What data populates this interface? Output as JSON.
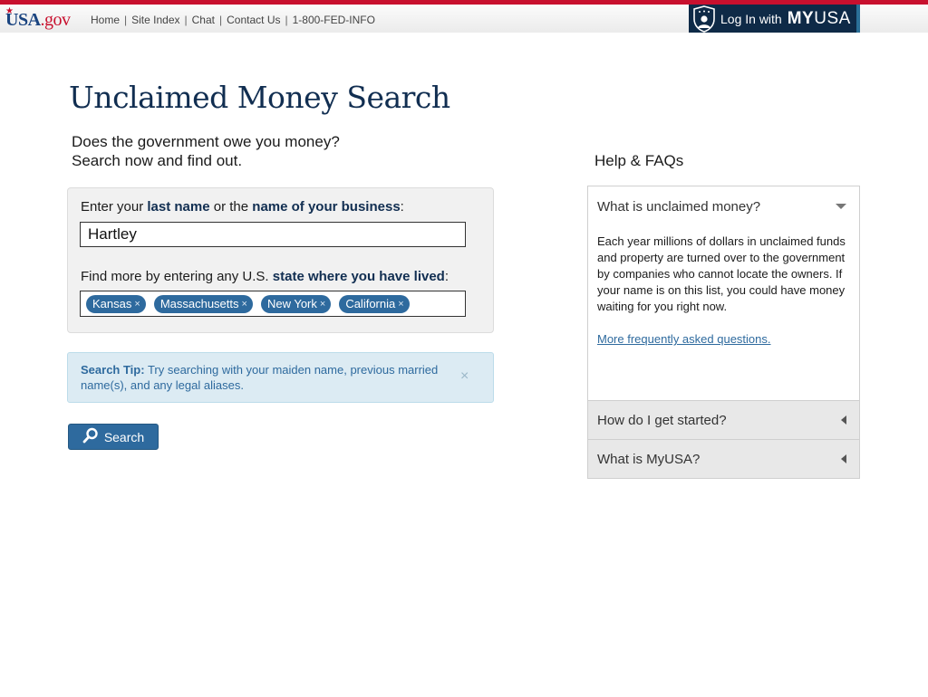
{
  "header": {
    "logo_text_main": "USA",
    "logo_text_suffix": ".gov",
    "nav": [
      "Home",
      "Site Index",
      "Chat",
      "Contact Us",
      "1-800-FED-INFO"
    ],
    "login_prefix": "Log In with",
    "brand_bold": "MY",
    "brand_light": "USA"
  },
  "main": {
    "title": "Unclaimed Money Search",
    "intro_line1": "Does the government owe you money?",
    "intro_line2": "Search now and find out.",
    "name_label_pre": "Enter your ",
    "name_label_b1": "last name",
    "name_label_mid": " or the ",
    "name_label_b2": "name of your business",
    "name_label_post": ":",
    "name_value": "Hartley",
    "state_label_pre": "Find more by entering any U.S. ",
    "state_label_b": "state where you have lived",
    "state_label_post": ":",
    "states": [
      "Kansas",
      "Massachusetts",
      "New York",
      "California"
    ],
    "chip_remove": "×",
    "tip_label": "Search Tip:",
    "tip_text": " Try searching with your maiden name, previous married name(s), and any legal aliases.",
    "tip_close": "×",
    "search_button": "Search"
  },
  "help": {
    "title": "Help & FAQs",
    "faqs": [
      {
        "question": "What is unclaimed money?",
        "open": true,
        "answer": "Each year millions of dollars in unclaimed funds and property are turned over to the government by companies who cannot locate the owners. If your name is on this list, you could have money waiting for you right now.",
        "link": "More frequently asked questions."
      },
      {
        "question": "How do I get started?",
        "open": false
      },
      {
        "question": "What is MyUSA?",
        "open": false
      }
    ]
  },
  "colors": {
    "accent_red": "#c8102e",
    "navy": "#112e51",
    "button_blue": "#2e6a9e",
    "tip_bg": "#dcebf3"
  }
}
